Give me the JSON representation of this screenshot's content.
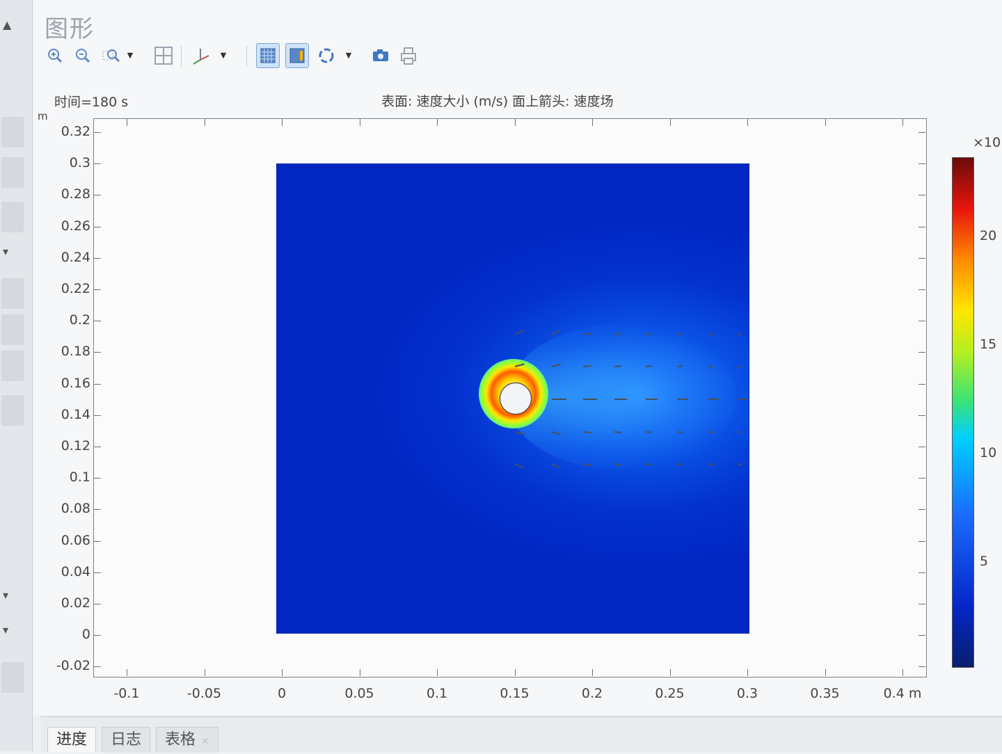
{
  "window": {
    "title": "图形"
  },
  "toolbar": {
    "icons": [
      "zoom-in-icon",
      "zoom-out-icon",
      "zoom-box-icon",
      "zoom-extents-icon",
      "axis-orientation-icon",
      "grid-toggle-icon",
      "legend-toggle-icon",
      "rotate-icon",
      "camera-icon",
      "print-icon"
    ],
    "active": [
      "grid-toggle-icon",
      "legend-toggle-icon"
    ]
  },
  "plot": {
    "time_label": "时间=180 s",
    "title": "表面: 速度大小 (m/s)   面上箭头: 速度场",
    "y_unit": "m",
    "x_unit": "m"
  },
  "chart_data": {
    "type": "heatmap",
    "title": "表面: 速度大小 (m/s)   面上箭头: 速度场",
    "subtitle": "时间=180 s",
    "xlabel": "m",
    "ylabel": "m",
    "x_ticks": [
      "-0.1",
      "-0.05",
      "0",
      "0.05",
      "0.1",
      "0.15",
      "0.2",
      "0.25",
      "0.3",
      "0.35",
      "0.4 m"
    ],
    "y_ticks": [
      "0.32",
      "0.3",
      "0.28",
      "0.26",
      "0.24",
      "0.22",
      "0.2",
      "0.18",
      "0.16",
      "0.14",
      "0.12",
      "0.1",
      "0.08",
      "0.06",
      "0.04",
      "0.02",
      "0",
      "-0.02"
    ],
    "xlim": [
      -0.12,
      0.42
    ],
    "ylim": [
      -0.025,
      0.33
    ],
    "domain": {
      "x": [
        0,
        0.3
      ],
      "y": [
        0,
        0.3
      ]
    },
    "obstacle": {
      "type": "circle",
      "center": [
        0.15,
        0.15
      ],
      "radius": 0.01
    },
    "colorbar": {
      "multiplier": "×10",
      "ticks": [
        "20",
        "15",
        "10",
        "5"
      ],
      "colormap": "rainbow"
    },
    "grid": false
  },
  "bottom_tabs": [
    {
      "label": "进度",
      "active": true
    },
    {
      "label": "日志",
      "active": false
    },
    {
      "label": "表格",
      "active": false,
      "close": "×"
    }
  ]
}
